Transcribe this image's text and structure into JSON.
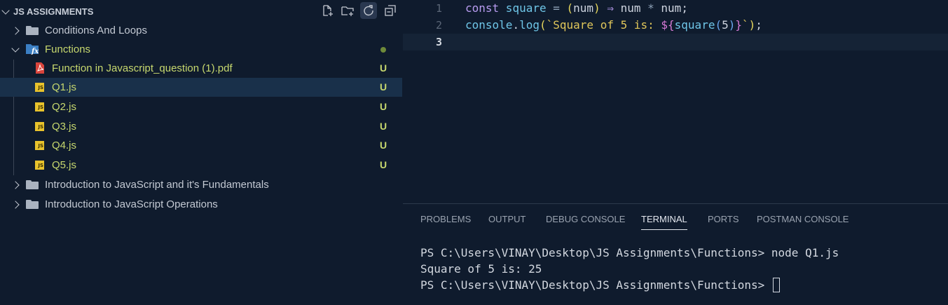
{
  "explorer": {
    "title": "JS ASSIGNMENTS",
    "actions": [
      "new-file-icon",
      "new-folder-icon",
      "refresh-icon",
      "collapse-all-icon"
    ],
    "tree": [
      {
        "label": "Conditions And Loops",
        "type": "folder",
        "expanded": false
      },
      {
        "label": "Functions",
        "type": "folder",
        "expanded": true,
        "status": "modified-dot"
      },
      {
        "label": "Function in Javascript_question (1).pdf",
        "type": "pdf",
        "status": "U"
      },
      {
        "label": "Q1.js",
        "type": "js",
        "status": "U",
        "selected": true
      },
      {
        "label": "Q2.js",
        "type": "js",
        "status": "U"
      },
      {
        "label": "Q3.js",
        "type": "js",
        "status": "U"
      },
      {
        "label": "Q4.js",
        "type": "js",
        "status": "U"
      },
      {
        "label": "Q5.js",
        "type": "js",
        "status": "U"
      },
      {
        "label": "Introduction to JavaScript and it's Fundamentals",
        "type": "folder",
        "expanded": false
      },
      {
        "label": "Introduction to JavaScript Operations",
        "type": "folder",
        "expanded": false
      }
    ],
    "js_icon_text": "JS"
  },
  "editor": {
    "line_numbers": [
      "1",
      "2",
      "3"
    ],
    "active_line": 3,
    "line1": {
      "t1": "const",
      "t2": " square",
      "t3": " = ",
      "t4": "(",
      "t5": "num",
      "t6": ")",
      "t7": " ⇒ ",
      "t8": "num ",
      "t9": "*",
      "t10": " num;"
    },
    "line2": {
      "t1": "console",
      "t2": ".",
      "t3": "log",
      "t4": "(",
      "t5": "`Square of 5 is: ",
      "t6": "${",
      "t7": "square",
      "t8": "(",
      "t9": "5",
      "t10": ")",
      "t11": "}",
      "t12": "`",
      "t13": ")",
      "t14": ";"
    }
  },
  "panel": {
    "tabs": [
      "PROBLEMS",
      "OUTPUT",
      "DEBUG CONSOLE",
      "TERMINAL",
      "PORTS",
      "POSTMAN CONSOLE"
    ],
    "active_tab": "TERMINAL",
    "terminal": [
      "PS C:\\Users\\VINAY\\Desktop\\JS Assignments\\Functions> node Q1.js",
      "Square of 5 is: 25",
      "PS C:\\Users\\VINAY\\Desktop\\JS Assignments\\Functions> "
    ]
  },
  "colors": {
    "background": "#0f1b2d",
    "git_untracked": "#c7d86e",
    "selection": "#19304a",
    "keyword": "#b89cf0",
    "function": "#6fc6e8",
    "string": "#e0c65a"
  }
}
